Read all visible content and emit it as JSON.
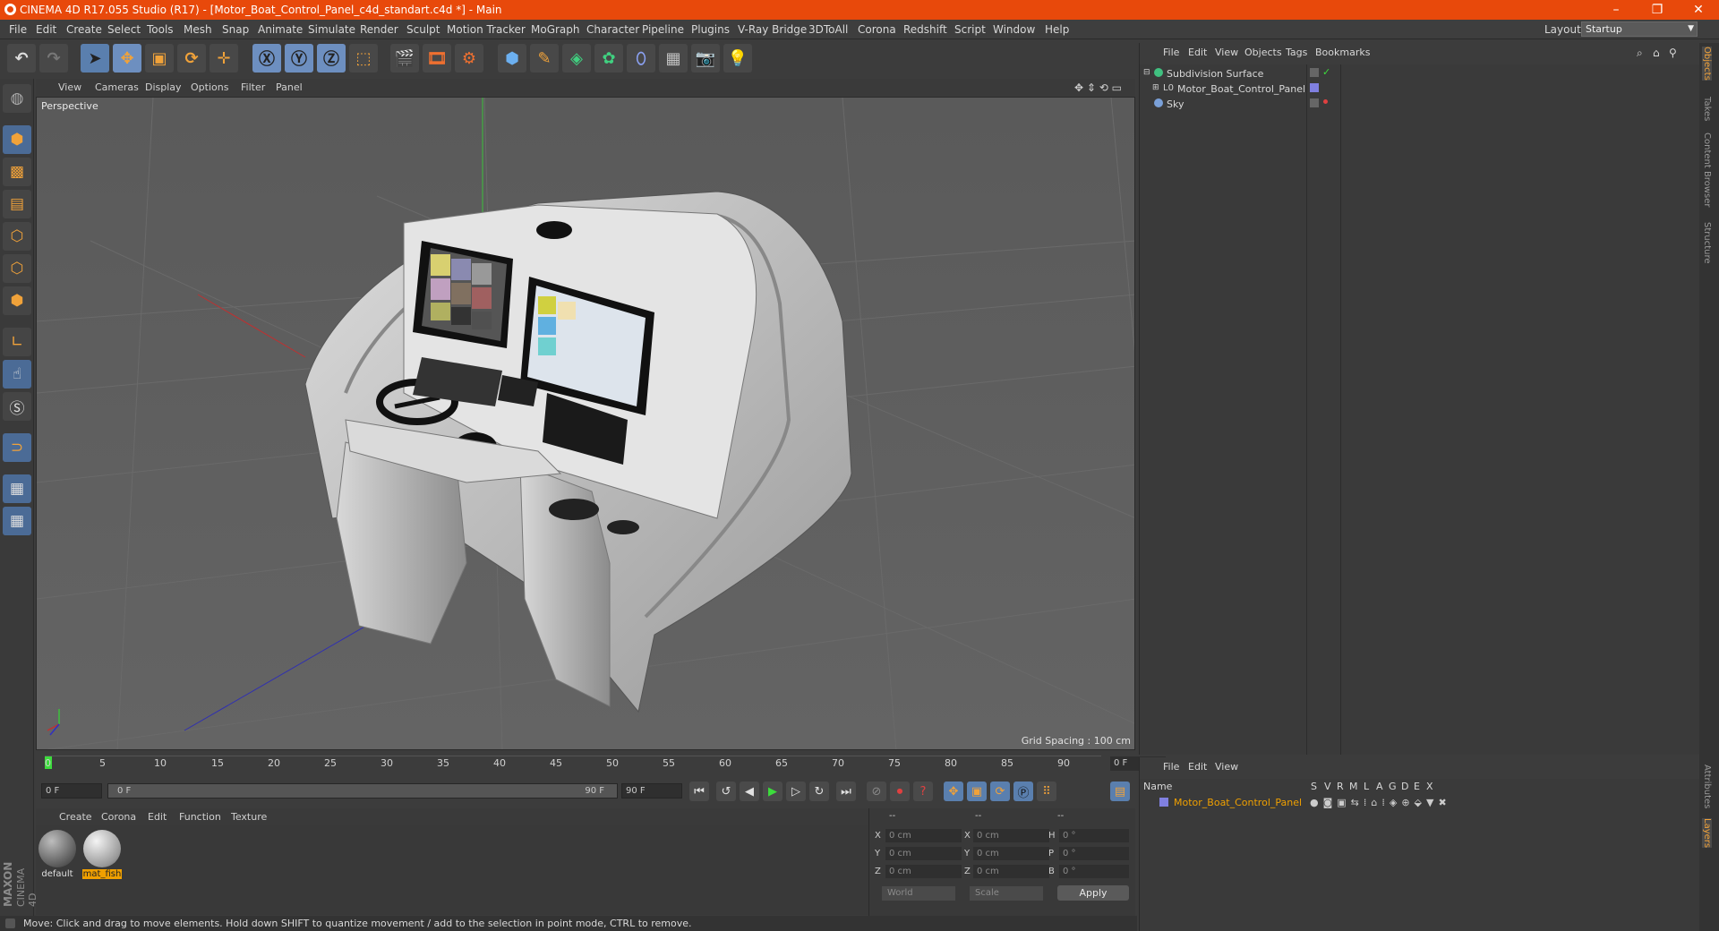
{
  "window": {
    "title": "CINEMA 4D R17.055 Studio (R17) - [Motor_Boat_Control_Panel_c4d_standart.c4d *] - Main",
    "minimize": "–",
    "restore": "❐",
    "close": "✕"
  },
  "menubar": {
    "items": [
      "File",
      "Edit",
      "Create",
      "Select",
      "Tools",
      "Mesh",
      "Snap",
      "Animate",
      "Simulate",
      "Render",
      "Sculpt",
      "Motion Tracker",
      "MoGraph",
      "Character",
      "Pipeline",
      "Plugins",
      "V-Ray Bridge",
      "3DToAll",
      "Corona",
      "Redshift",
      "Script",
      "Window",
      "Help"
    ],
    "layout_label": "Layout:",
    "layout_value": "Startup"
  },
  "viewport": {
    "menu": [
      "View",
      "Cameras",
      "Display",
      "Options",
      "Filter",
      "Panel"
    ],
    "label": "Perspective",
    "grid_spacing": "Grid Spacing : 100 cm"
  },
  "timeline": {
    "ticks": [
      "0",
      "5",
      "10",
      "15",
      "20",
      "25",
      "30",
      "35",
      "40",
      "45",
      "50",
      "55",
      "60",
      "65",
      "70",
      "75",
      "80",
      "85",
      "90"
    ],
    "frame_field": "0 F",
    "start": "0 F",
    "range_start": "0 F",
    "range_end": "90 F",
    "end": "90 F"
  },
  "materials": {
    "menu": [
      "Create",
      "Corona",
      "Edit",
      "Function",
      "Texture"
    ],
    "items": [
      {
        "name": "default"
      },
      {
        "name": "mat_fish"
      }
    ]
  },
  "coords": {
    "header": [
      "--",
      "--",
      "--"
    ],
    "rows": [
      {
        "a": "X",
        "a_val": "0 cm",
        "b": "X",
        "b_val": "0 cm",
        "c": "H",
        "c_val": "0 °"
      },
      {
        "a": "Y",
        "a_val": "0 cm",
        "b": "Y",
        "b_val": "0 cm",
        "c": "P",
        "c_val": "0 °"
      },
      {
        "a": "Z",
        "a_val": "0 cm",
        "b": "Z",
        "b_val": "0 cm",
        "c": "B",
        "c_val": "0 °"
      }
    ],
    "world": "World",
    "scale": "Scale",
    "apply": "Apply"
  },
  "status": "Move: Click and drag to move elements. Hold down SHIFT to quantize movement / add to the selection in point mode, CTRL to remove.",
  "brand": {
    "line1": "MAXON",
    "line2": "CINEMA 4D"
  },
  "objects": {
    "menu": [
      "File",
      "Edit",
      "View",
      "Objects",
      "Tags",
      "Bookmarks"
    ],
    "items": [
      {
        "name": "Subdivision Surface",
        "indent": 0
      },
      {
        "name": "Motor_Boat_Control_Panel",
        "indent": 1
      },
      {
        "name": "Sky",
        "indent": 0
      }
    ]
  },
  "layers": {
    "menu": [
      "File",
      "Edit",
      "View"
    ],
    "header_name": "Name",
    "columns": [
      "S",
      "V",
      "R",
      "M",
      "L",
      "A",
      "G",
      "D",
      "E",
      "X"
    ],
    "rows": [
      {
        "name": "Motor_Boat_Control_Panel"
      }
    ]
  },
  "right_tabs": [
    "Objects",
    "Takes",
    "Content Browser",
    "Structure",
    "Attributes",
    "Layers"
  ],
  "colors": {
    "titlebar": "#e8490b",
    "accent_orange": "#f0a23a",
    "layer_color": "#8080e0",
    "selected_material_label": "#f0a000"
  }
}
